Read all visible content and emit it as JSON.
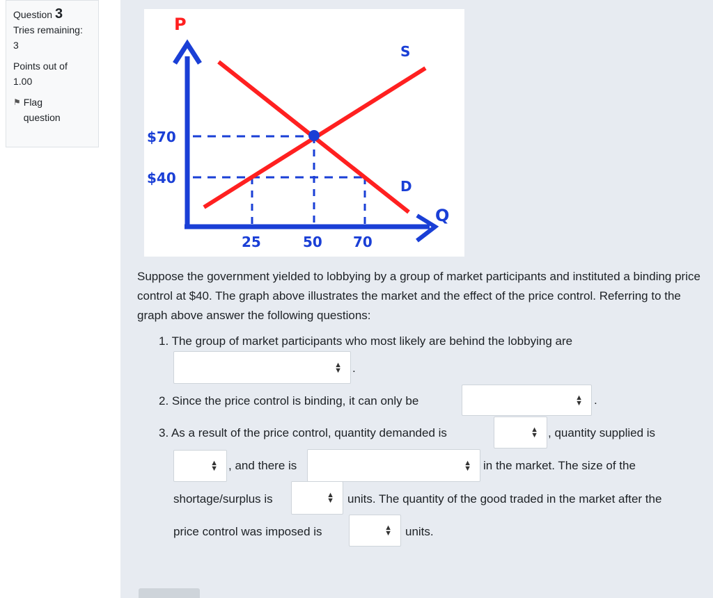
{
  "info": {
    "question_label": "Question",
    "question_number": "3",
    "tries_label": "Tries remaining:",
    "tries_value": "3",
    "points_label": "Points out of",
    "points_value": "1.00",
    "flag_label_1": "Flag",
    "flag_label_2": "question",
    "flag_icon": "flag-outline-icon"
  },
  "graph": {
    "p_label": "P",
    "q_label": "Q",
    "s_label": "S",
    "d_label": "D",
    "price_high": "$70",
    "price_low": "$40",
    "q_ticks": [
      "25",
      "50",
      "70"
    ],
    "colors": {
      "axis": "#1a3fd6",
      "curves": "#ff2020",
      "dashes": "#1a3fd6",
      "point": "#1a3fd6"
    }
  },
  "question": {
    "intro": "Suppose the government yielded to lobbying by a group of market participants and instituted a binding price control at $40. The graph above illustrates the market and the effect of the price control. Referring to the graph above answer the following questions:",
    "q1_text": "1. The group of market participants who most likely are behind the lobbying are",
    "q2_text": "2. Since the price control is binding, it can only be",
    "q3_part1": "3. As a result of the price control, quantity demanded is",
    "q3_part2": ", quantity supplied is",
    "q3_part3": ", and there is",
    "q3_part4": "in the market. The size of the",
    "q3_part5": "shortage/surplus is",
    "q3_part6": "units. The quantity of the good traded in the market after the",
    "q3_part7": "price control was imposed is",
    "q3_part8": "units.",
    "period": "."
  }
}
